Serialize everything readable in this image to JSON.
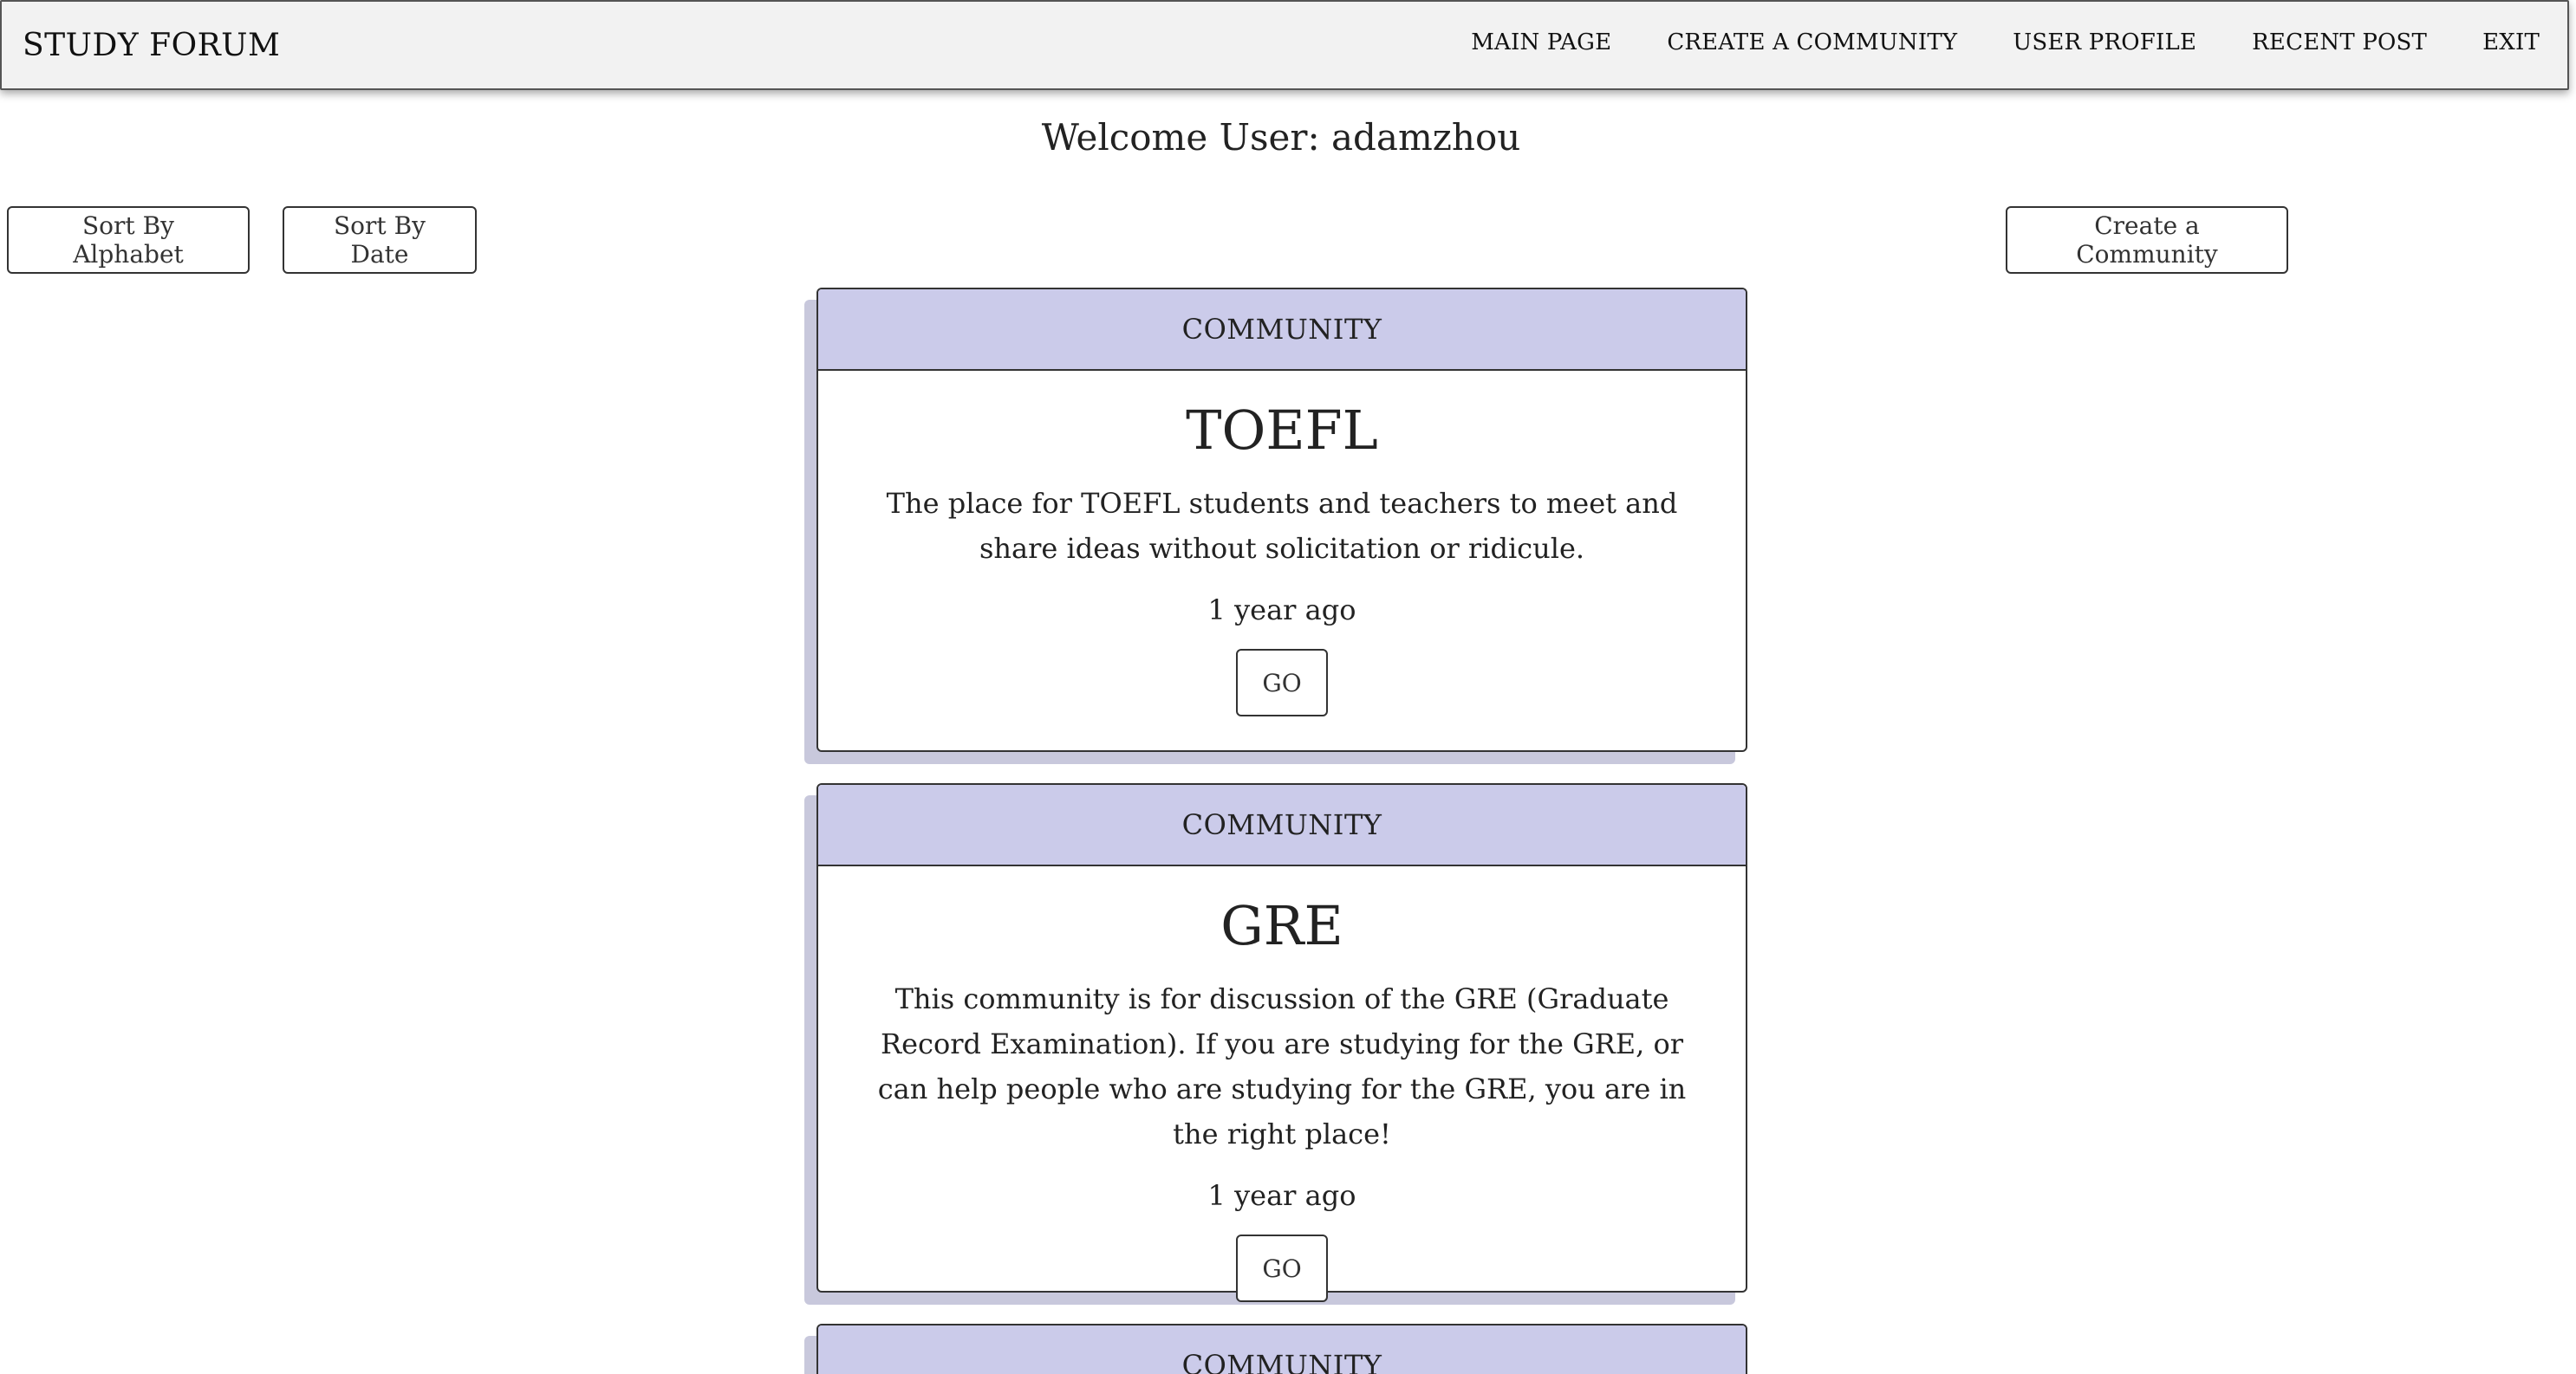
{
  "nav": {
    "brand": "STUDY FORUM",
    "links": [
      "MAIN PAGE",
      "CREATE A COMMUNITY",
      "USER PROFILE",
      "RECENT POST",
      "EXIT"
    ]
  },
  "welcome": "Welcome User: adamzhou",
  "controls": {
    "sort_alpha": "Sort By Alphabet",
    "sort_date": "Sort By Date",
    "create": "Create a Community"
  },
  "communities": [
    {
      "header": "COMMUNITY",
      "title": "TOEFL",
      "description": "The place for TOEFL students and teachers to meet and share ideas without solicitation or ridicule.",
      "date": "1 year ago",
      "button": "GO"
    },
    {
      "header": "COMMUNITY",
      "title": "GRE",
      "description": "This community is for discussion of the GRE (Graduate Record Examination). If you are studying for the GRE, or can help people who are studying for the GRE, you are in the right place!",
      "date": "1 year ago",
      "button": "GO"
    },
    {
      "header": "COMMUNITY"
    }
  ],
  "colors": {
    "card_header": "#cbcbea",
    "navbar": "#f2f2f2"
  }
}
